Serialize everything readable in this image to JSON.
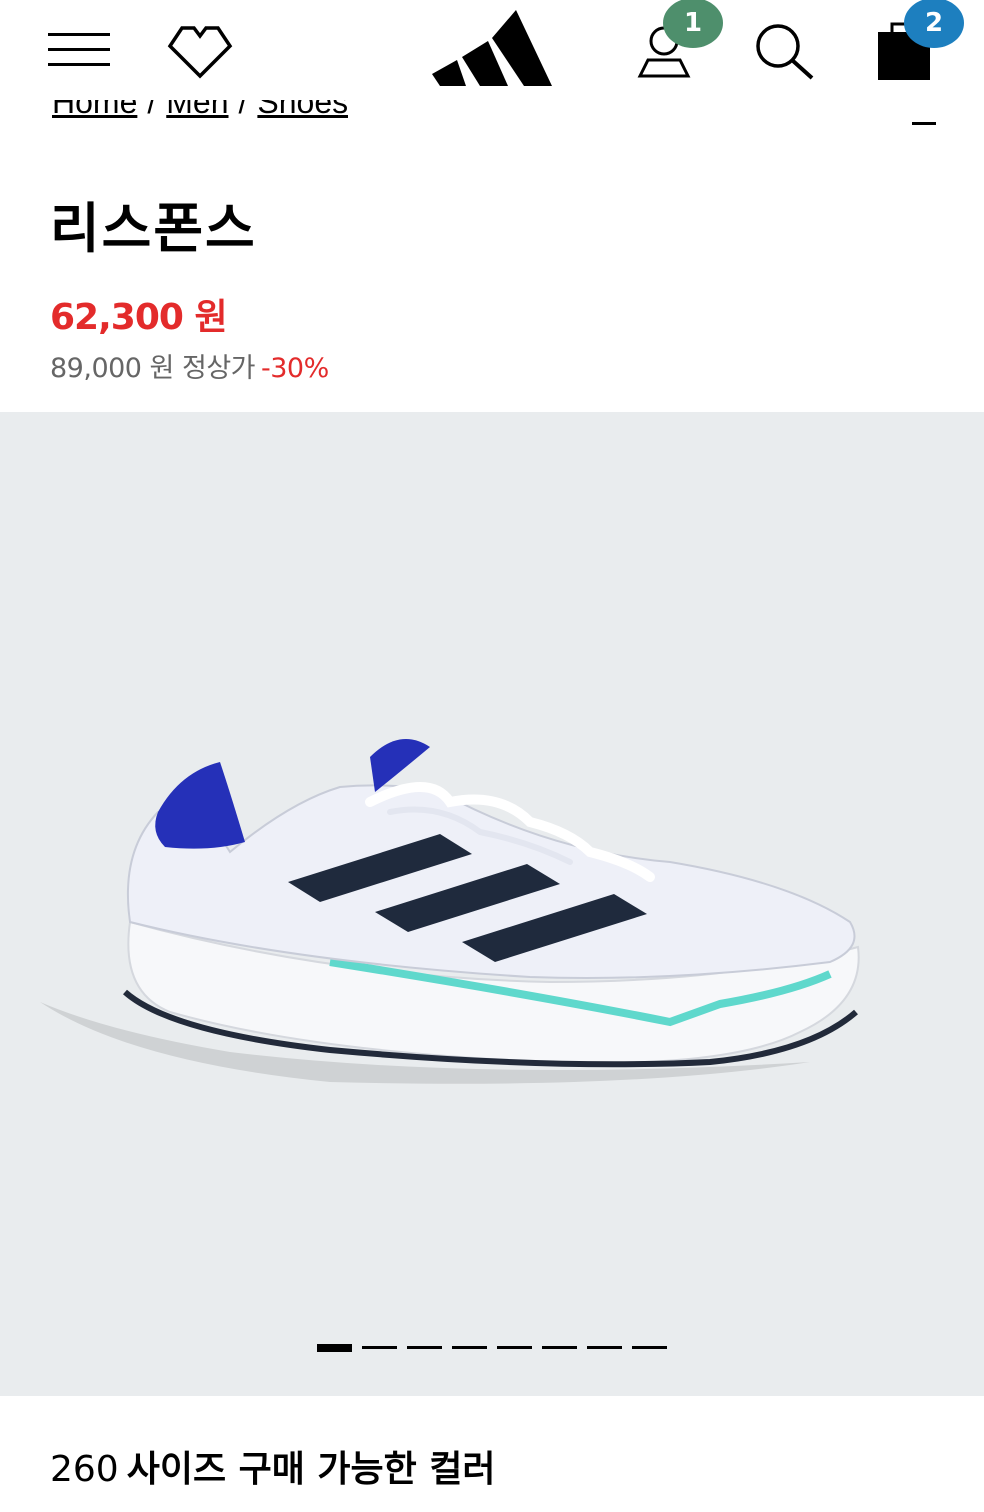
{
  "header": {
    "menu_icon": "hamburger-menu-icon",
    "wishlist_icon": "heart-icon",
    "logo": "adidas-logo",
    "account_icon": "user-icon",
    "account_badge": "1",
    "search_icon": "search-icon",
    "bag_icon": "shopping-bag-icon",
    "bag_badge": "2",
    "colors": {
      "account_badge": "#4e8f6c",
      "bag_badge": "#1d7fbf"
    }
  },
  "breadcrumb": [
    "Home",
    "Men",
    "Shoes"
  ],
  "product": {
    "title": "리스폰스",
    "sale_price": "62,300 원",
    "original_price": "89,000 원 정상가",
    "discount": "-30%",
    "colors": {
      "sale": "#e32b2b"
    }
  },
  "gallery": {
    "image": "product-image-running-shoe",
    "slide_count": 8,
    "active_slide": 1
  },
  "colors_section": {
    "size": "260",
    "label": "사이즈 구매 가능한 컬러"
  }
}
